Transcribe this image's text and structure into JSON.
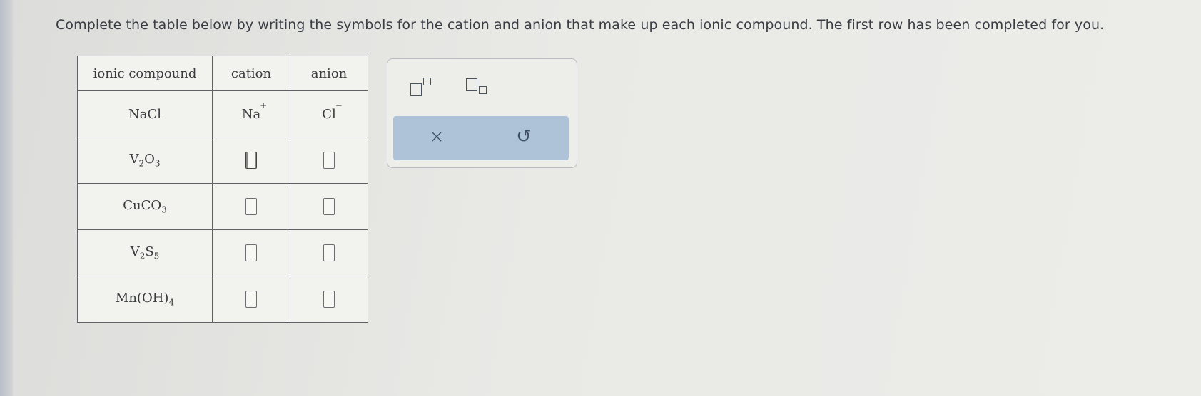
{
  "instruction": "Complete the table below by writing the symbols for the cation and anion that make up each ionic compound. The first row has been completed for you.",
  "table": {
    "headers": [
      "ionic compound",
      "cation",
      "anion"
    ],
    "rows": [
      {
        "compound": {
          "parts": [
            [
              "Na",
              ""
            ],
            [
              "Cl",
              ""
            ]
          ]
        },
        "cation": {
          "symbol": "Na",
          "charge": "+"
        },
        "anion": {
          "symbol": "Cl",
          "charge": "−"
        }
      },
      {
        "compound": {
          "parts": [
            [
              "V",
              "2"
            ],
            [
              "O",
              "3"
            ]
          ]
        },
        "cation": null,
        "anion": null
      },
      {
        "compound": {
          "parts": [
            [
              "CuCO",
              "3"
            ]
          ]
        },
        "cation": null,
        "anion": null
      },
      {
        "compound": {
          "parts": [
            [
              "V",
              "2"
            ],
            [
              "S",
              "5"
            ]
          ]
        },
        "cation": null,
        "anion": null
      },
      {
        "compound": {
          "parts": [
            [
              "Mn(OH)",
              "4"
            ]
          ]
        },
        "cation": null,
        "anion": null
      }
    ]
  },
  "toolbar": {
    "superscript_icon": "superscript-template-icon",
    "subscript_icon": "subscript-template-icon",
    "clear_symbol": "×",
    "undo_symbol": "↺"
  }
}
